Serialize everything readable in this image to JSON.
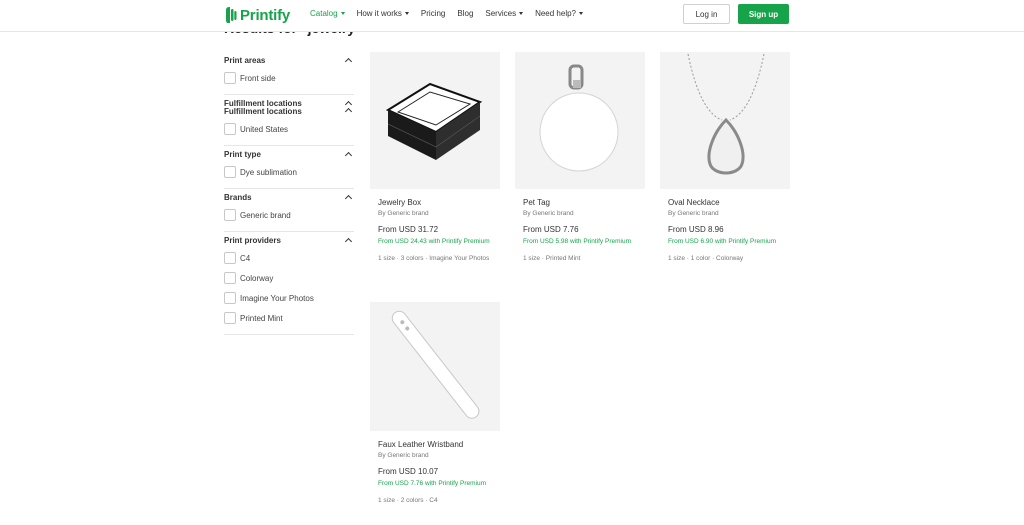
{
  "header": {
    "logo_text": "Printify",
    "nav": [
      {
        "label": "Catalog",
        "active": true,
        "dropdown": true
      },
      {
        "label": "How it works",
        "active": false,
        "dropdown": true
      },
      {
        "label": "Pricing",
        "active": false,
        "dropdown": false
      },
      {
        "label": "Blog",
        "active": false,
        "dropdown": false
      },
      {
        "label": "Services",
        "active": false,
        "dropdown": true
      },
      {
        "label": "Need help?",
        "active": false,
        "dropdown": true
      }
    ],
    "login_label": "Log in",
    "signup_label": "Sign up"
  },
  "results_heading": "Results for \"jewelry\"",
  "filters": [
    {
      "title": "Print areas",
      "options": [
        "Front side"
      ]
    },
    {
      "title": "Fulfillment locations",
      "options": [
        "United States"
      ]
    },
    {
      "title": "Print type",
      "options": [
        "Dye sublimation"
      ]
    },
    {
      "title": "Brands",
      "options": [
        "Generic brand"
      ]
    },
    {
      "title": "Print providers",
      "options": [
        "C4",
        "Colorway",
        "Imagine Your Photos",
        "Printed Mint"
      ]
    }
  ],
  "products": [
    {
      "name": "Jewelry Box",
      "brand": "By Generic brand",
      "price": "From USD 31.72",
      "premium": "From USD 24.43 with Printify Premium",
      "meta": "1 size · 3 colors · Imagine Your Photos",
      "image": "jewelry-box"
    },
    {
      "name": "Pet Tag",
      "brand": "By Generic brand",
      "price": "From USD 7.76",
      "premium": "From USD 5.98 with Printify Premium",
      "meta": "1 size · Printed Mint",
      "image": "pet-tag"
    },
    {
      "name": "Oval Necklace",
      "brand": "By Generic brand",
      "price": "From USD 8.96",
      "premium": "From USD 6.90 with Printify Premium",
      "meta": "1 size · 1 color · Colorway",
      "image": "oval-necklace"
    },
    {
      "name": "Faux Leather Wristband",
      "brand": "By Generic brand",
      "price": "From USD 10.07",
      "premium": "From USD 7.76 with Printify Premium",
      "meta": "1 size · 2 colors · C4",
      "image": "wristband"
    }
  ],
  "colors": {
    "brand_green": "#17a34a",
    "card_bg": "#f3f3f3"
  }
}
